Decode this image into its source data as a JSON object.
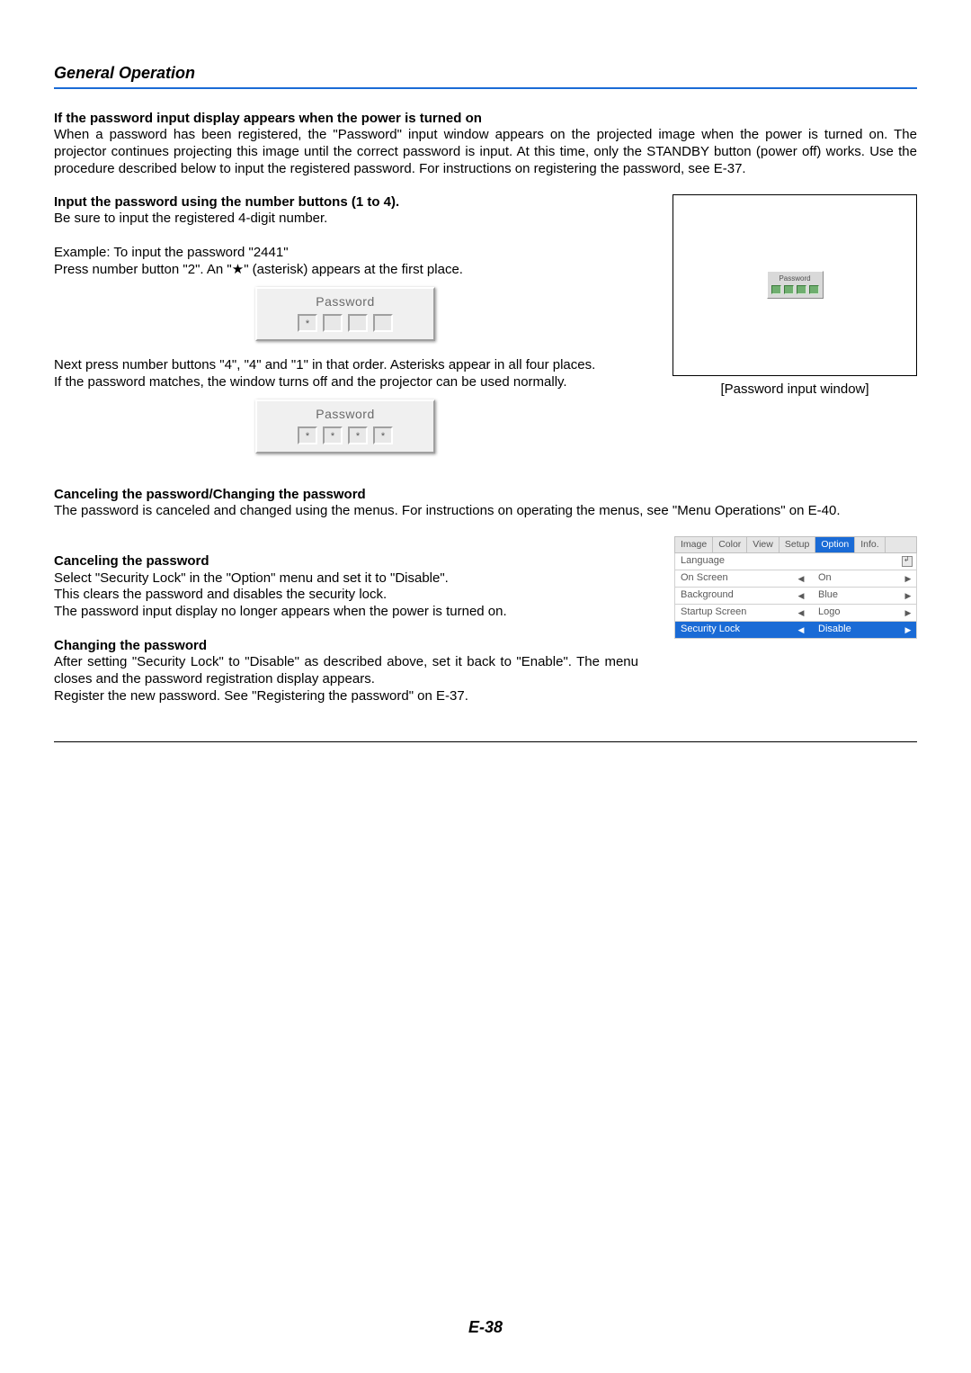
{
  "section_title": "General Operation",
  "blocks": {
    "b1_heading": "If the password input display appears when the power is turned on",
    "b1_body": "When a password has been registered, the \"Password\" input window appears on the projected image when the power is turned on. The projector continues projecting this image until the correct password is input. At this time, only the STANDBY button (power off) works. Use the procedure described below to input the registered password. For instructions on registering the password, see E-37.",
    "b2_heading": "Input the password using the number buttons (1 to 4).",
    "b2_line1": "Be sure to input the registered 4-digit number.",
    "b2_line2": "Example: To input the password \"2441\"",
    "b2_line3": "Press number button \"2\". An \"★\" (asterisk) appears at the first place.",
    "b2_line4": "Next press number buttons \"4\", \"4\" and \"1\" in that order. Asterisks appear in all four places.",
    "b2_line5": "If the password matches, the window turns off and the projector can be used normally.",
    "b3_heading": "Canceling the password/Changing the password",
    "b3_body": "The password is canceled and changed using the menus. For instructions on operating the menus, see \"Menu Operations\" on E-40.",
    "cancel_heading": "Canceling the password",
    "cancel_l1": "Select \"Security Lock\" in the \"Option\" menu and set it to \"Disable\".",
    "cancel_l2": "This clears the password and disables the security lock.",
    "cancel_l3": "The password input display no longer appears when the power is turned on.",
    "change_heading": "Changing the password",
    "change_l1": "After setting \"Security Lock\" to \"Disable\" as described above, set it back to \"Enable\". The menu closes and the password registration display appears.",
    "change_l2": "Register the new password. See \"Registering the password\" on E-37."
  },
  "password_dialog": {
    "title": "Password"
  },
  "projection": {
    "inner_title": "Password",
    "caption": "[Password input window]"
  },
  "option_menu": {
    "tabs": [
      "Image",
      "Color",
      "View",
      "Setup",
      "Option",
      "Info."
    ],
    "active_tab": 4,
    "rows": [
      {
        "label": "Language",
        "value": "",
        "enter": true,
        "arrows": false
      },
      {
        "label": "On Screen",
        "value": "On",
        "enter": false,
        "arrows": true
      },
      {
        "label": "Background",
        "value": "Blue",
        "enter": false,
        "arrows": true
      },
      {
        "label": "Startup Screen",
        "value": "Logo",
        "enter": false,
        "arrows": true
      },
      {
        "label": "Security Lock",
        "value": "Disable",
        "enter": false,
        "arrows": true,
        "active": true
      }
    ]
  },
  "page_number": "E-38"
}
